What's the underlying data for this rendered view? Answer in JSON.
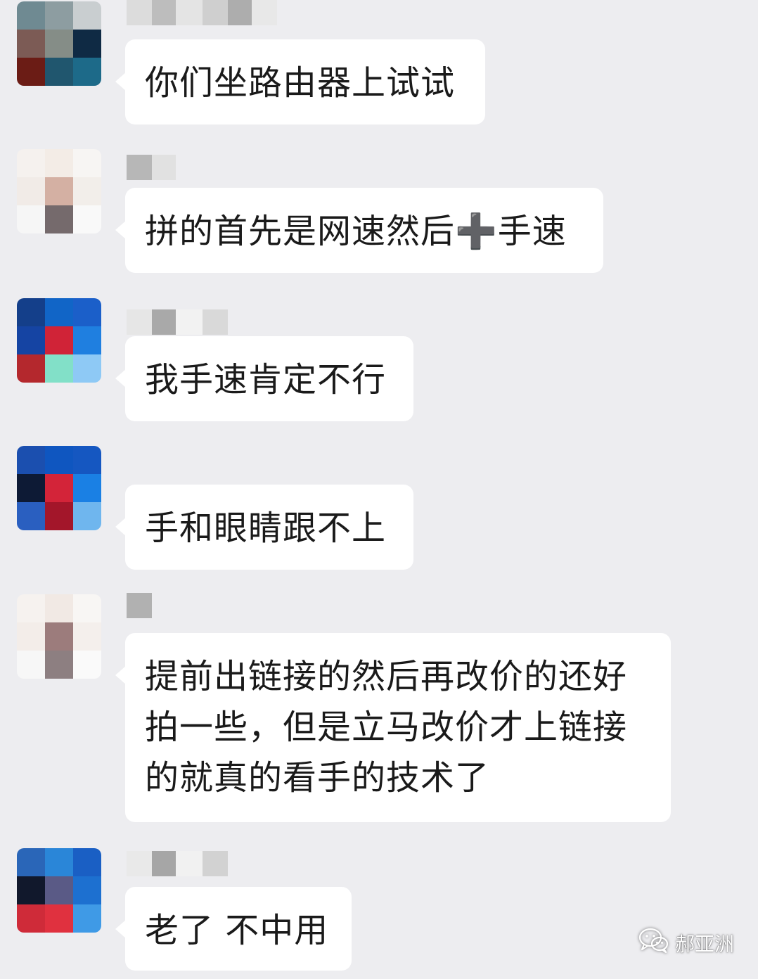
{
  "conversation": {
    "messages": [
      {
        "text": "你们坐路由器上试试",
        "avatar_colors": [
          "#6f8a92",
          "#8d9da1",
          "#c9ced0",
          "#7c5b55",
          "#858d87",
          "#0f2a44",
          "#6b1c15",
          "#20566e",
          "#1d6a89"
        ],
        "name_colors": [
          "#dcdcdc",
          "#bdbdbd",
          "#e4e4e4",
          "#cfcfcf",
          "#adadad",
          "#e8e8e8"
        ]
      },
      {
        "text": "拼的首先是网速然后➕手速",
        "avatar_colors": [
          "#f5f1ee",
          "#f3ece6",
          "#f7f5f3",
          "#f1ebe7",
          "#d4b0a3",
          "#f2eeea",
          "#f6f6f6",
          "#756a6c",
          "#f9f9f9"
        ],
        "name_colors": [
          "#b7b7b7",
          "#e1e1e1"
        ]
      },
      {
        "text": "我手速肯定不行",
        "avatar_colors": [
          "#143f8a",
          "#1165c7",
          "#1b5fc9",
          "#1544a3",
          "#d02337",
          "#1f7fe0",
          "#b4282d",
          "#82e0c8",
          "#8ec9f5"
        ],
        "name_colors": [
          "#e6e6e6",
          "#a9a9a9",
          "#f2f2f2",
          "#d9d9d9"
        ]
      },
      {
        "text": "手和眼睛跟不上",
        "avatar_colors": [
          "#1b4faf",
          "#0f56c0",
          "#1557c1",
          "#0d1a35",
          "#d32439",
          "#1a80e4",
          "#2a5fc0",
          "#a3162a",
          "#6fb6ee"
        ],
        "name_colors": []
      },
      {
        "text": "提前出链接的然后再改价的还好拍一些，但是立马改价才上链接的就真的看手的技术了",
        "avatar_colors": [
          "#f6f2ef",
          "#f1e9e4",
          "#f8f6f4",
          "#f3ede9",
          "#9c7c7c",
          "#f4efec",
          "#f7f7f7",
          "#8d7f81",
          "#fafafa"
        ],
        "name_colors": [
          "#b1b1b1"
        ]
      },
      {
        "text": "老了 不中用",
        "avatar_colors": [
          "#2a66b8",
          "#2a86d8",
          "#1a5fc4",
          "#11182c",
          "#5a5a86",
          "#1d70d0",
          "#cf2b39",
          "#e0313f",
          "#3f9ae6"
        ],
        "name_colors": [
          "#e9e9e9",
          "#a6a6a6",
          "#f1f1f1",
          "#d2d2d2"
        ]
      }
    ]
  },
  "watermark": {
    "icon": "wechat-icon",
    "label": "郝亚洲"
  }
}
